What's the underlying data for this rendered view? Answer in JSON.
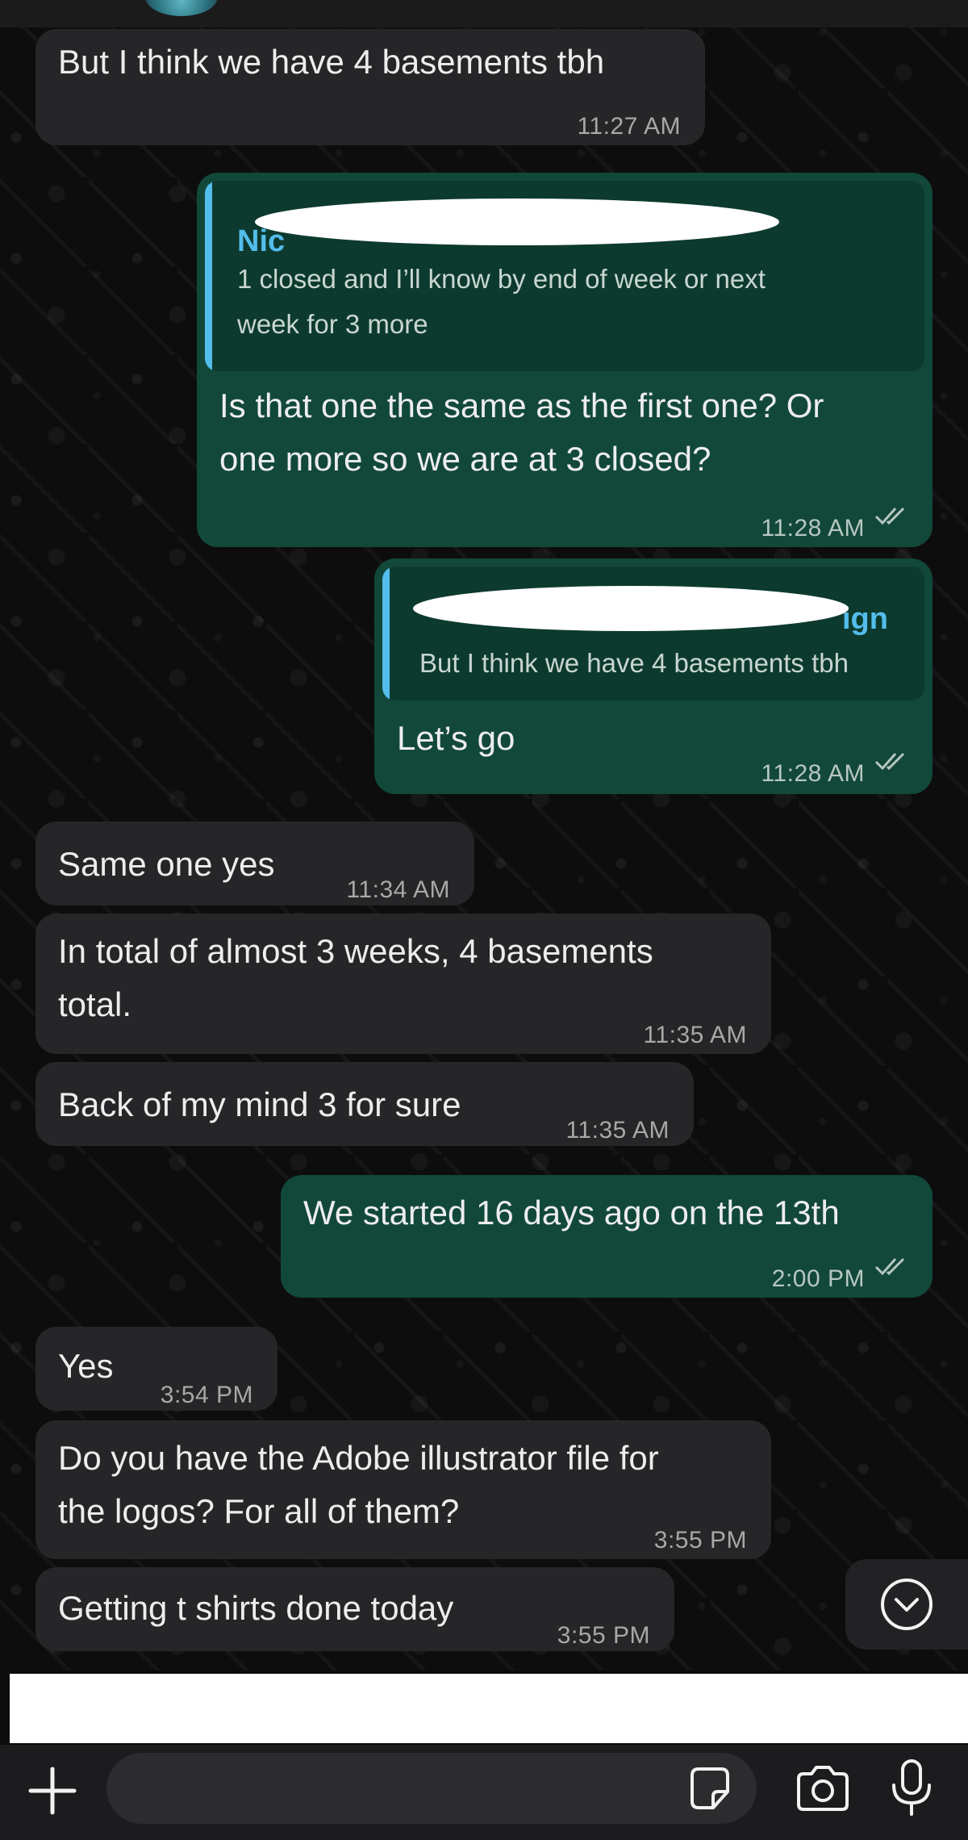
{
  "messages": [
    {
      "id": "m1",
      "direction": "incoming",
      "text": "But I think we have 4 basements tbh",
      "time": "11:27 AM"
    },
    {
      "id": "m2",
      "direction": "outgoing",
      "quoted_name": "Nic",
      "quoted_text": "1 closed and I’ll know by end of week or next\nweek for 3 more",
      "text": "Is that one the same as the first one? Or\none more so we are at 3 closed?",
      "time": "11:28 AM"
    },
    {
      "id": "m3",
      "direction": "outgoing",
      "quoted_name": "ign",
      "quoted_text": "But I think we have 4 basements tbh",
      "text": "Let’s go",
      "time": "11:28 AM"
    },
    {
      "id": "m4",
      "direction": "incoming",
      "text": "Same one yes",
      "time": "11:34 AM"
    },
    {
      "id": "m5",
      "direction": "incoming",
      "text": "In total of almost 3 weeks, 4 basements\ntotal.",
      "time": "11:35 AM"
    },
    {
      "id": "m6",
      "direction": "incoming",
      "text": "Back of my mind 3 for sure",
      "time": "11:35 AM"
    },
    {
      "id": "m7",
      "direction": "outgoing",
      "text": "We started 16 days ago on the 13th",
      "time": "2:00 PM"
    },
    {
      "id": "m8",
      "direction": "incoming",
      "text": "Yes",
      "time": "3:54 PM"
    },
    {
      "id": "m9",
      "direction": "incoming",
      "text": "Do you have the Adobe illustrator file for\nthe logos? For all of them?",
      "time": "3:55 PM"
    },
    {
      "id": "m10",
      "direction": "incoming",
      "text": "Getting t shirts done today",
      "time": "3:55 PM"
    }
  ],
  "composer": {
    "placeholder": "",
    "icons": [
      "plus-icon",
      "sticker-icon",
      "camera-icon",
      "microphone-icon"
    ]
  },
  "scroll_button_icon": "chevron-down-icon",
  "colors": {
    "incoming_bubble": "#262628",
    "outgoing_bubble": "#12483a",
    "quote_accent": "#53bdeb",
    "read_ticks": "#b6c7c0"
  }
}
